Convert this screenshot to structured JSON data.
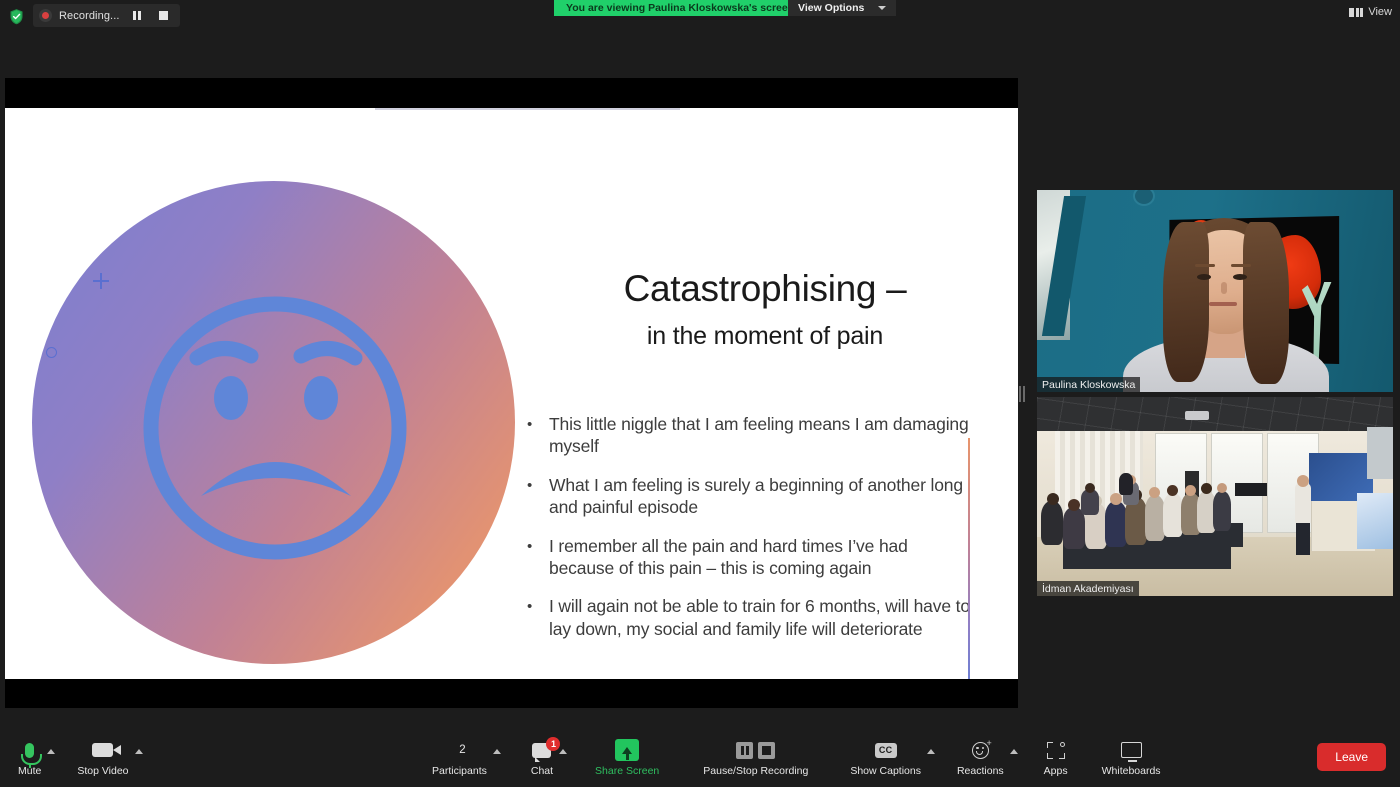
{
  "topbar": {
    "shield_icon": "shield-check-icon",
    "recording": {
      "label": "Recording...",
      "pause_icon": "pause-icon",
      "stop_icon": "stop-icon"
    },
    "viewing_banner": "You are viewing Paulina Kloskowska's screen",
    "view_options_label": "View Options",
    "view_button_label": "View"
  },
  "slide": {
    "title": "Catastrophising –",
    "subtitle": "in the moment of pain",
    "bullet_marker": "•",
    "bullets": [
      "This little niggle that I am feeling means I am damaging myself",
      "What I am feeling is surely a beginning of another long and painful episode",
      "I remember all the pain and hard times I’ve had because of this pain – this is coming again",
      "I will again not be able to train for 6 months, will have to lay down, my social and family life will deteriorate"
    ],
    "graphic_icon": "sad-face-icon",
    "decorations": [
      "plus-icon",
      "ring-icon",
      "dot-icon"
    ],
    "colors": {
      "gradient_start": "#7b7fd0",
      "gradient_end": "#e8956c",
      "face_stroke": "#5f86d8",
      "accent_line_top": "#e8956c",
      "accent_line_bottom": "#5f7fd8"
    }
  },
  "gallery": {
    "tiles": [
      {
        "name": "Paulina Kloskowska"
      },
      {
        "name": "İdman Akademiyası"
      }
    ]
  },
  "toolbar": {
    "mute": {
      "label": "Mute",
      "icon": "microphone-icon"
    },
    "stop_video": {
      "label": "Stop Video",
      "icon": "camera-icon"
    },
    "participants": {
      "label": "Participants",
      "icon": "people-icon",
      "count": "2"
    },
    "chat": {
      "label": "Chat",
      "icon": "chat-bubble-icon",
      "badge": "1"
    },
    "share_screen": {
      "label": "Share Screen",
      "icon": "share-screen-icon"
    },
    "pause_stop_recording": {
      "label": "Pause/Stop Recording",
      "pause_icon": "pause-icon",
      "stop_icon": "stop-icon"
    },
    "show_captions": {
      "label": "Show Captions",
      "icon": "closed-caption-icon",
      "cc_text": "CC"
    },
    "reactions": {
      "label": "Reactions",
      "icon": "smiley-plus-icon"
    },
    "apps": {
      "label": "Apps",
      "icon": "apps-icon"
    },
    "whiteboards": {
      "label": "Whiteboards",
      "icon": "whiteboard-icon"
    },
    "leave": {
      "label": "Leave",
      "color": "#d92c2c"
    }
  }
}
